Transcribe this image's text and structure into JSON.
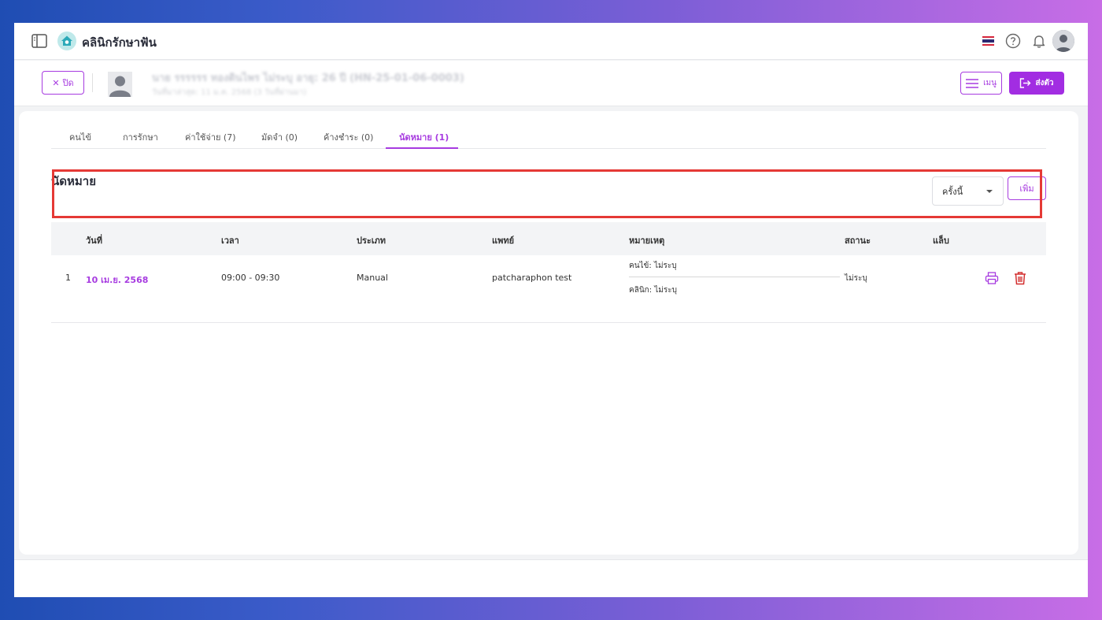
{
  "header": {
    "app_title": "คลินิกรักษาฟัน"
  },
  "patient": {
    "close_label": "ปิด",
    "name_line": "นาย รรรรรร ทองดินไพร ไม่ระบุ อายุ: 26 ปี (HN-25-01-06-0003)",
    "sub_line": "วันที่มาล่าสุด: 11 ม.ค. 2568 (3 วันที่ผ่านมา)",
    "menu_label": "เมนู",
    "send_label": "ส่งตัว"
  },
  "tabs": [
    {
      "label": "คนไข้"
    },
    {
      "label": "การรักษา"
    },
    {
      "label": "ค่าใช้จ่าย (7)"
    },
    {
      "label": "มัดจำ (0)"
    },
    {
      "label": "ค้างชำระ (0)"
    },
    {
      "label": "นัดหมาย (1)"
    }
  ],
  "section": {
    "title": "นัดหมาย",
    "filter_value": "ครั้งนี้",
    "add_label": "เพิ่ม"
  },
  "table": {
    "columns": [
      "วันที่",
      "เวลา",
      "ประเภท",
      "แพทย์",
      "หมายเหตุ",
      "สถานะ",
      "แล็บ"
    ],
    "rows": [
      {
        "index": "1",
        "date": "10 เม.ย. 2568",
        "time": "09:00 - 09:30",
        "type": "Manual",
        "doctor": "patcharaphon test",
        "note_patient": "คนไข้: ไม่ระบุ",
        "note_clinic": "คลินิก: ไม่ระบุ",
        "status": "ไม่ระบุ"
      }
    ]
  },
  "colors": {
    "accent": "#a73be0",
    "highlight": "#e53935"
  }
}
